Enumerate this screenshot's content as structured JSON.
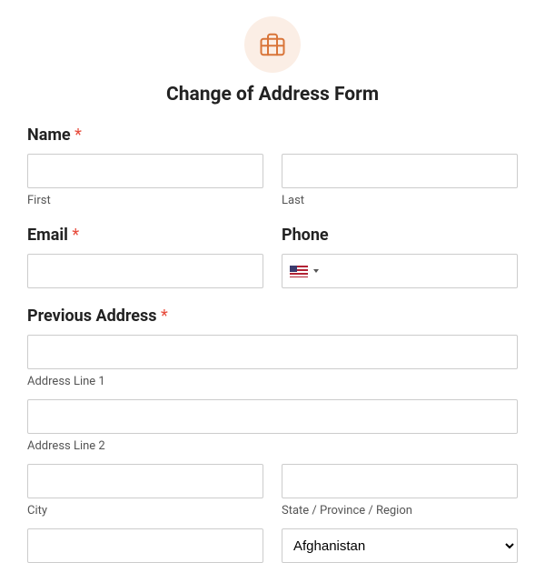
{
  "header": {
    "title": "Change of Address Form",
    "icon": "briefcase-icon"
  },
  "fields": {
    "name": {
      "label": "Name",
      "required": "*",
      "first_sub": "First",
      "last_sub": "Last"
    },
    "email": {
      "label": "Email",
      "required": "*"
    },
    "phone": {
      "label": "Phone"
    },
    "previous_address": {
      "label": "Previous Address",
      "required": "*",
      "line1_sub": "Address Line 1",
      "line2_sub": "Address Line 2",
      "city_sub": "City",
      "state_sub": "State / Province / Region",
      "country_selected": "Afghanistan"
    }
  }
}
